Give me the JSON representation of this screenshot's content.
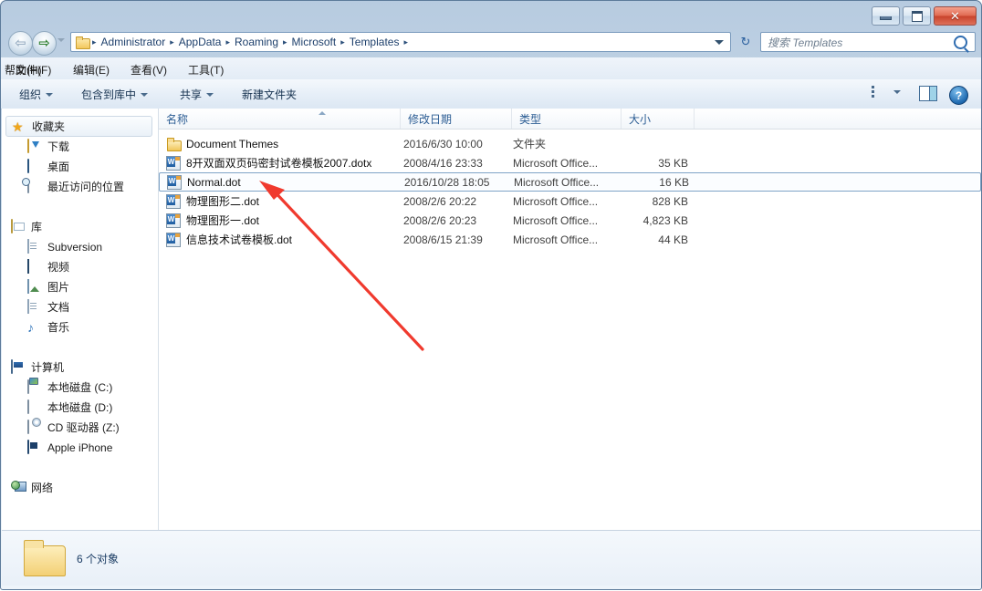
{
  "window": {
    "controls": {
      "minimize": "—",
      "maximize": "□",
      "close": "✕"
    }
  },
  "address": {
    "back_label": "◀",
    "forward_label": "▶",
    "history_label": "▾",
    "refresh_label": "↻",
    "crumbs": [
      "Administrator",
      "AppData",
      "Roaming",
      "Microsoft",
      "Templates"
    ],
    "separator": "▸",
    "dropdown_label": "▾"
  },
  "search": {
    "placeholder": "搜索 Templates",
    "icon": "search-icon"
  },
  "menu": {
    "items": [
      "文件(F)",
      "编辑(E)",
      "查看(V)",
      "工具(T)",
      "帮助(H)"
    ]
  },
  "toolbar": {
    "organize": "组织",
    "include_in_library": "包含到库中",
    "share": "共享",
    "new_folder": "新建文件夹",
    "help_label": "?"
  },
  "sidebar": {
    "groups": [
      {
        "header": {
          "label": "收藏夹",
          "icon": "star-icon",
          "selected": true
        },
        "items": [
          {
            "label": "下载",
            "icon": "download-folder-icon"
          },
          {
            "label": "桌面",
            "icon": "desktop-icon"
          },
          {
            "label": "最近访问的位置",
            "icon": "recent-places-icon"
          }
        ]
      },
      {
        "header": {
          "label": "库",
          "icon": "library-icon",
          "selected": false
        },
        "items": [
          {
            "label": "Subversion",
            "icon": "document-icon"
          },
          {
            "label": "视频",
            "icon": "video-icon"
          },
          {
            "label": "图片",
            "icon": "pictures-icon"
          },
          {
            "label": "文档",
            "icon": "documents-icon"
          },
          {
            "label": "音乐",
            "icon": "music-icon"
          }
        ]
      },
      {
        "header": {
          "label": "计算机",
          "icon": "computer-icon",
          "selected": false
        },
        "items": [
          {
            "label": "本地磁盘 (C:)",
            "icon": "system-drive-icon"
          },
          {
            "label": "本地磁盘 (D:)",
            "icon": "hard-drive-icon"
          },
          {
            "label": "CD 驱动器 (Z:)",
            "icon": "cd-drive-icon"
          },
          {
            "label": "Apple iPhone",
            "icon": "phone-icon"
          }
        ]
      },
      {
        "header": {
          "label": "网络",
          "icon": "network-icon",
          "selected": false
        },
        "items": []
      }
    ]
  },
  "filelist": {
    "columns": [
      {
        "label": "名称",
        "sorted": "asc"
      },
      {
        "label": "修改日期",
        "sorted": ""
      },
      {
        "label": "类型",
        "sorted": ""
      },
      {
        "label": "大小",
        "sorted": ""
      }
    ],
    "rows": [
      {
        "name": "Document Themes",
        "date": "2016/6/30 10:00",
        "type": "文件夹",
        "size": "",
        "icon": "folder-icon",
        "selected": false
      },
      {
        "name": "8开双面双页码密封试卷模板2007.dotx",
        "date": "2008/4/16 23:33",
        "type": "Microsoft Office...",
        "size": "35 KB",
        "icon": "word-document-icon",
        "selected": false
      },
      {
        "name": "Normal.dot",
        "date": "2016/10/28 18:05",
        "type": "Microsoft Office...",
        "size": "16 KB",
        "icon": "word-document-icon",
        "selected": true
      },
      {
        "name": "物理图形二.dot",
        "date": "2008/2/6 20:22",
        "type": "Microsoft Office...",
        "size": "828 KB",
        "icon": "word-document-icon",
        "selected": false
      },
      {
        "name": "物理图形一.dot",
        "date": "2008/2/6 20:23",
        "type": "Microsoft Office...",
        "size": "4,823 KB",
        "icon": "word-document-icon",
        "selected": false
      },
      {
        "name": "信息技术试卷模板.dot",
        "date": "2008/6/15 21:39",
        "type": "Microsoft Office...",
        "size": "44 KB",
        "icon": "word-document-icon",
        "selected": false
      }
    ]
  },
  "status": {
    "text": "6 个对象",
    "icon": "folder-icon"
  },
  "annotation": {
    "color": "#f03a2e",
    "type": "arrow"
  },
  "colors": {
    "accent": "#2c5d94",
    "selection_border": "#7da2c6",
    "close_button": "#c8432c",
    "annotation_red": "#f03a2e"
  }
}
